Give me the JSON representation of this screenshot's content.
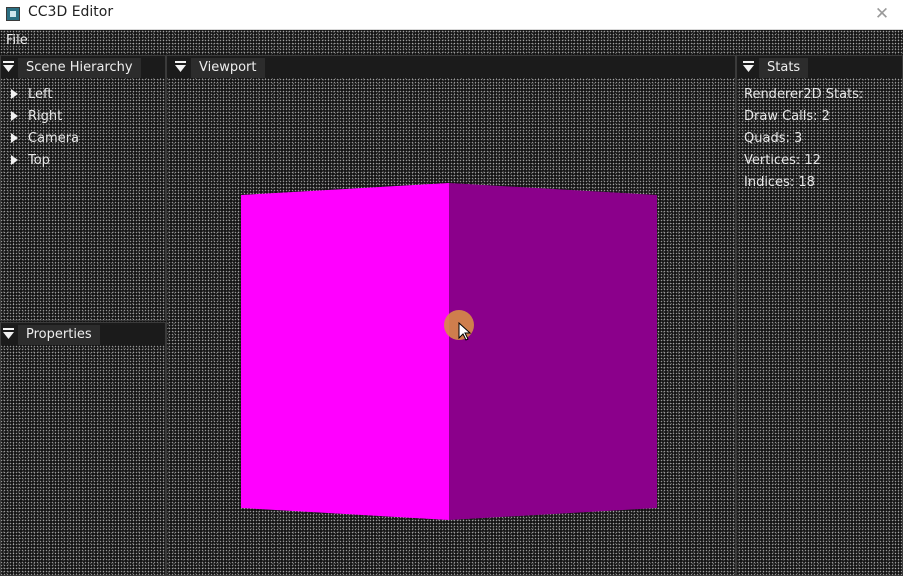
{
  "window": {
    "title": "CC3D Editor",
    "close_glyph": "✕"
  },
  "menu": {
    "items": [
      "File"
    ]
  },
  "panels": {
    "hierarchy": {
      "tab_label": "Scene Hierarchy",
      "items": [
        {
          "label": "Left"
        },
        {
          "label": "Right"
        },
        {
          "label": "Camera"
        },
        {
          "label": "Top"
        }
      ]
    },
    "properties": {
      "tab_label": "Properties"
    },
    "viewport": {
      "tab_label": "Viewport"
    },
    "stats": {
      "tab_label": "Stats",
      "lines": [
        "Renderer2D Stats:",
        "Draw Calls: 2",
        "Quads: 3",
        "Vertices: 12",
        "Indices: 18"
      ]
    }
  },
  "scene": {
    "cube_left_color": "#ff00ff",
    "cube_right_color": "#8b008b"
  },
  "colors": {
    "cursor_highlight": "#d68c46",
    "panel_border": "#3b3b3b",
    "tab_bg": "#2c2c2c"
  }
}
